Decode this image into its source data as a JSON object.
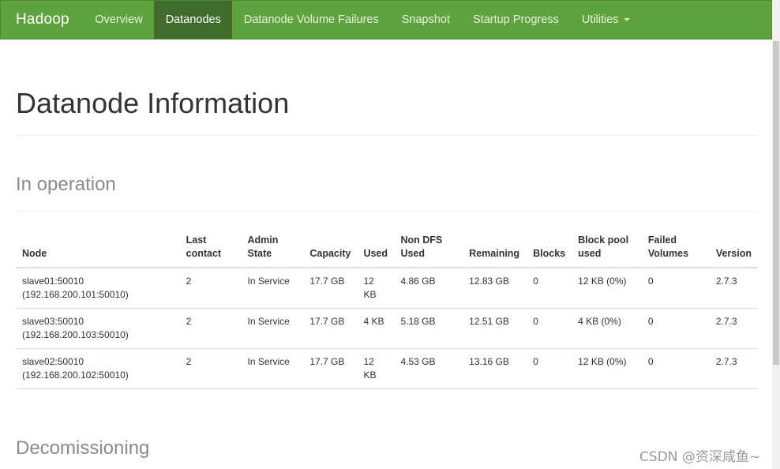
{
  "nav": {
    "brand": "Hadoop",
    "items": [
      {
        "label": "Overview"
      },
      {
        "label": "Datanodes"
      },
      {
        "label": "Datanode Volume Failures"
      },
      {
        "label": "Snapshot"
      },
      {
        "label": "Startup Progress"
      },
      {
        "label": "Utilities"
      }
    ]
  },
  "page": {
    "title": "Datanode Information",
    "in_operation": "In operation",
    "decommissioning": "Decomissioning"
  },
  "table": {
    "headers": [
      "Node",
      "Last contact",
      "Admin State",
      "Capacity",
      "Used",
      "Non DFS Used",
      "Remaining",
      "Blocks",
      "Block pool used",
      "Failed Volumes",
      "Version"
    ],
    "rows": [
      {
        "node": "slave01:50010 (192.168.200.101:50010)",
        "last_contact": "2",
        "admin_state": "In Service",
        "capacity": "17.7 GB",
        "used": "12 KB",
        "non_dfs_used": "4.86 GB",
        "remaining": "12.83 GB",
        "blocks": "0",
        "block_pool_used": "12 KB (0%)",
        "failed_volumes": "0",
        "version": "2.7.3"
      },
      {
        "node": "slave03:50010 (192.168.200.103:50010)",
        "last_contact": "2",
        "admin_state": "In Service",
        "capacity": "17.7 GB",
        "used": "4 KB",
        "non_dfs_used": "5.18 GB",
        "remaining": "12.51 GB",
        "blocks": "0",
        "block_pool_used": "4 KB (0%)",
        "failed_volumes": "0",
        "version": "2.7.3"
      },
      {
        "node": "slave02:50010 (192.168.200.102:50010)",
        "last_contact": "2",
        "admin_state": "In Service",
        "capacity": "17.7 GB",
        "used": "12 KB",
        "non_dfs_used": "4.53 GB",
        "remaining": "13.16 GB",
        "blocks": "0",
        "block_pool_used": "12 KB (0%)",
        "failed_volumes": "0",
        "version": "2.7.3"
      }
    ]
  },
  "watermark": "CSDN @资深咸鱼~",
  "colors": {
    "navbar": "#5fa33e",
    "navbar_active": "#3f6c2c"
  },
  "icons": {
    "utilities_caret": "chevron-down-icon"
  }
}
